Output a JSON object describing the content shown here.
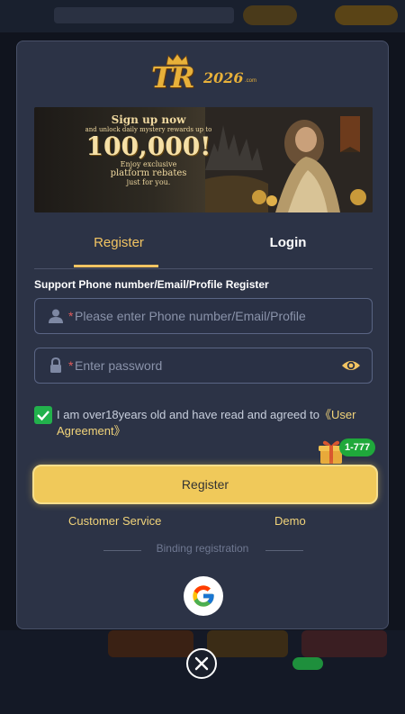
{
  "brand": {
    "logo_main": "TR",
    "logo_year": "2026",
    "logo_suffix": ".com"
  },
  "banner": {
    "line1": "Sign up now",
    "line2": "and unlock daily mystery rewards up to",
    "amount": "100,000!",
    "line3": "Enjoy exclusive",
    "line4": "platform rebates",
    "line5": "just for you."
  },
  "tabs": {
    "register": "Register",
    "login": "Login",
    "active": "Register"
  },
  "form": {
    "support_label": "Support Phone number/Email/Profile Register",
    "account_placeholder": "Please enter Phone number/Email/Profile",
    "password_placeholder": "Enter password",
    "required_mark": "*",
    "agreement_text": "I am over18years old and have read and agreed to",
    "agreement_link": "《User Agreement》",
    "agreement_checked": true
  },
  "promo": {
    "badge": "1-777"
  },
  "actions": {
    "register_button": "Register",
    "customer_service": "Customer Service",
    "demo": "Demo",
    "binding_label": "Binding registration"
  },
  "icons": {
    "user": "user-icon",
    "lock": "lock-icon",
    "eye": "eye-icon",
    "check": "check-icon",
    "gift": "gift-icon",
    "google": "google-icon",
    "close": "close-icon"
  },
  "colors": {
    "accent": "#f2c462",
    "button": "#f0c95a",
    "panel": "#2c3346",
    "success": "#22b14c",
    "link": "#f2d47a"
  }
}
